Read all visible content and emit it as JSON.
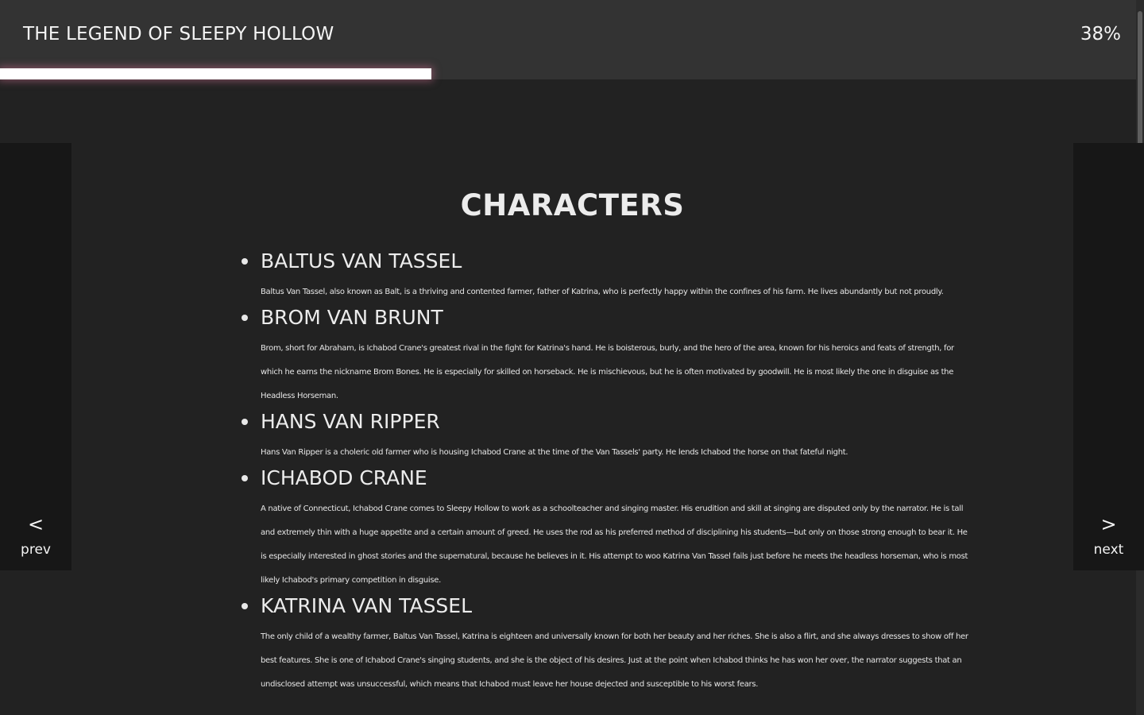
{
  "header": {
    "book_title": "THE LEGEND OF SLEEPY HOLLOW",
    "progress_text": "38%",
    "progress_fraction": 0.38
  },
  "navigation": {
    "prev_arrow": "<",
    "prev_label": "prev",
    "next_arrow": ">",
    "next_label": "next"
  },
  "chapter": {
    "heading": "CHARACTERS",
    "characters": [
      {
        "name": "BALTUS VAN TASSEL",
        "description": "Baltus Van Tassel, also known as Balt, is a thriving and contented farmer, father of Katrina, who is perfectly happy within the confines of his farm. He lives abundantly but not proudly."
      },
      {
        "name": "BROM VAN BRUNT",
        "description": "Brom, short for Abraham, is Ichabod Crane's greatest rival in the fight for Katrina's hand. He is boisterous, burly, and the hero of the area, known for his heroics and feats of strength, for which he earns the nickname Brom Bones. He is especially for skilled on horseback. He is mischievous, but he is often motivated by goodwill. He is most likely the one in disguise as the Headless Horseman."
      },
      {
        "name": "HANS VAN RIPPER",
        "description": "Hans Van Ripper is a choleric old farmer who is housing Ichabod Crane at the time of the Van Tassels' party. He lends Ichabod the horse on that fateful night."
      },
      {
        "name": "ICHABOD CRANE",
        "description": "A native of Connecticut, Ichabod Crane comes to Sleepy Hollow to work as a schoolteacher and singing master. His erudition and skill at singing are disputed only by the narrator. He is tall and extremely thin with a huge appetite and a certain amount of greed. He uses the rod as his preferred method of disciplining his students—but only on those strong enough to bear it. He is especially interested in ghost stories and the supernatural, because he believes in it. His attempt to woo Katrina Van Tassel fails just before he meets the headless horseman, who is most likely Ichabod's primary competition in disguise."
      },
      {
        "name": "KATRINA VAN TASSEL",
        "description": "The only child of a wealthy farmer, Baltus Van Tassel, Katrina is eighteen and universally known for both her beauty and her riches. She is also a flirt, and she always dresses to show off her best features. She is one of Ichabod Crane's singing students, and she is the object of his desires. Just at the point when Ichabod thinks he has won her over, the narrator suggests that an undisclosed attempt was unsuccessful, which means that Ichabod must leave her house dejected and susceptible to his worst fears."
      }
    ]
  }
}
